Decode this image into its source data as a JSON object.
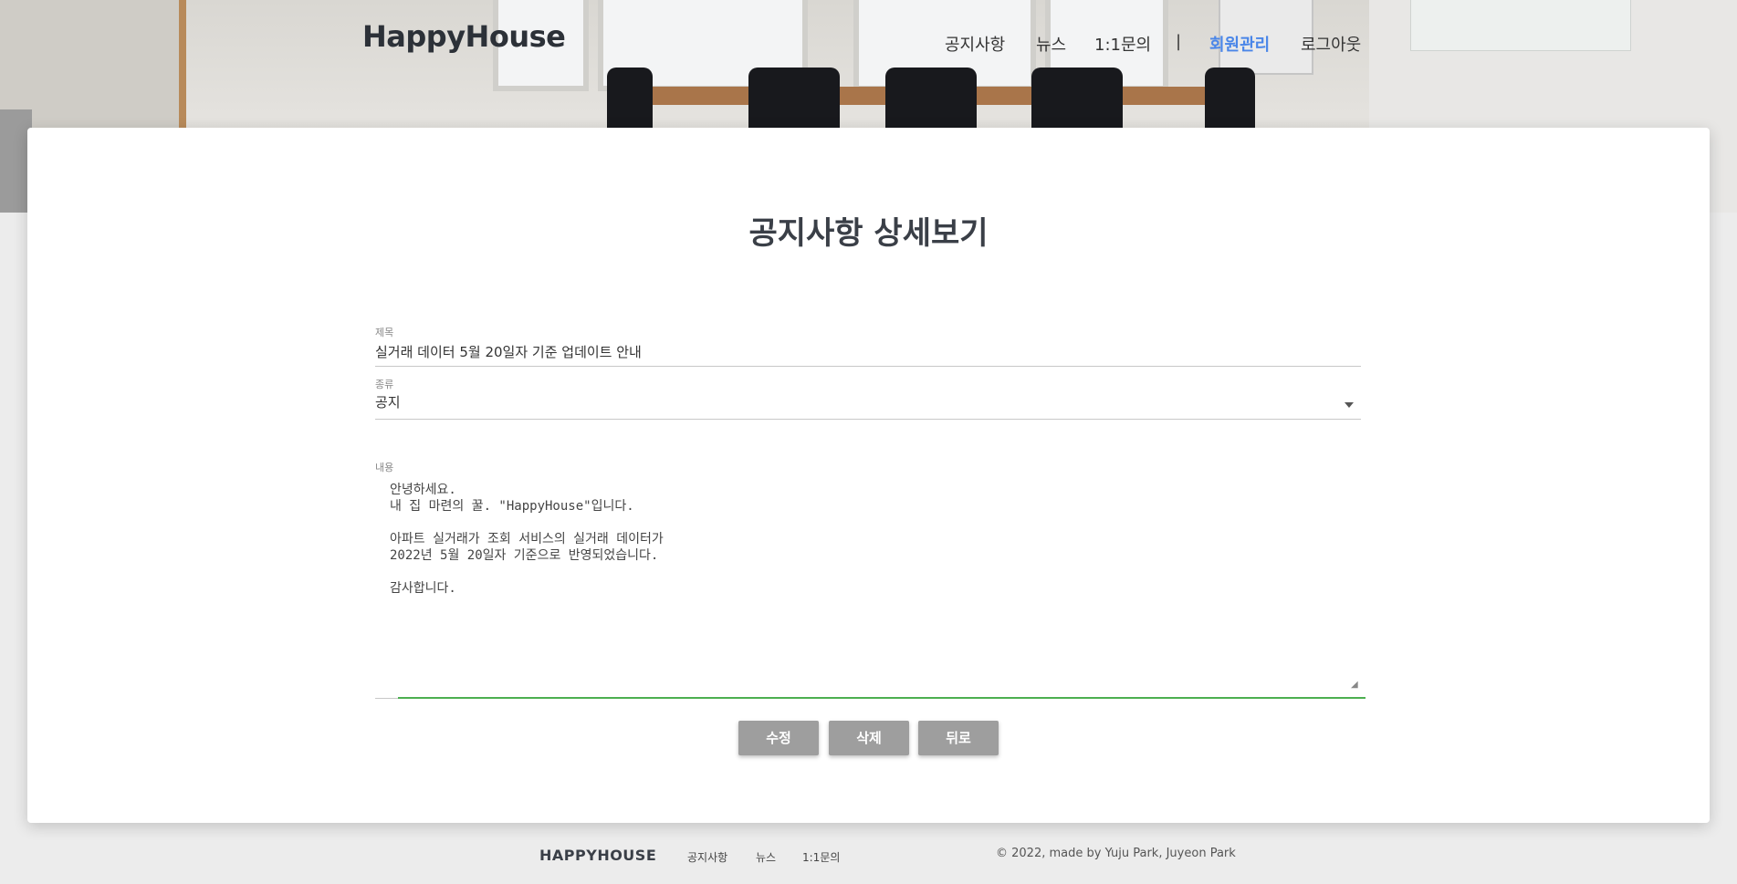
{
  "header": {
    "logo": "HappyHouse",
    "nav": [
      "공지사항",
      "뉴스",
      "1:1문의",
      "회원관리",
      "로그아웃"
    ],
    "separator": "|",
    "active_item": "회원관리",
    "accent_color": "#4a86e8"
  },
  "page": {
    "title": "공지사항 상세보기",
    "title_label": "제목",
    "title_value": "실거래 데이터 5월 20일자 기준 업데이트 안내",
    "type_label": "종류",
    "type_value": "공지",
    "content_label": "내용",
    "content_value": "안녕하세요.\n내 집 마련의 꿀. \"HappyHouse\"입니다.\n\n아파트 실거래가 조회 서비스의 실거래 데이터가\n2022년 5월 20일자 기준으로 반영되었습니다.\n\n감사합니다."
  },
  "buttons": {
    "edit": "수정",
    "delete": "삭제",
    "back": "뒤로"
  },
  "footer": {
    "logo": "HAPPYHOUSE",
    "links": [
      "공지사항",
      "뉴스",
      "1:1문의"
    ],
    "copyright": "© 2022, made by Yuju Park, Juyeon Park"
  },
  "icons": {
    "select": "chevron-down-icon",
    "resize": "resize-grip-icon"
  },
  "colors": {
    "focus_line": "#4caf50",
    "button_bg": "#9e9e9e"
  }
}
